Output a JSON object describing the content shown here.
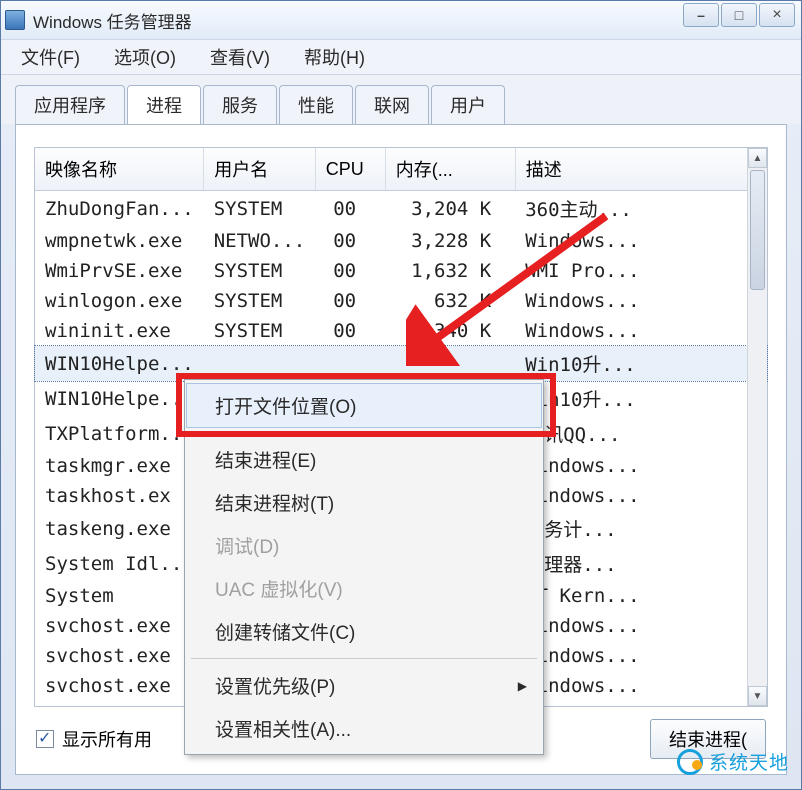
{
  "window": {
    "title": "Windows 任务管理器"
  },
  "menu": {
    "file": "文件(F)",
    "options": "选项(O)",
    "view": "查看(V)",
    "help": "帮助(H)"
  },
  "tabs": {
    "apps": "应用程序",
    "processes": "进程",
    "services": "服务",
    "performance": "性能",
    "networking": "联网",
    "users": "用户"
  },
  "columns": {
    "image": "映像名称",
    "user": "用户名",
    "cpu": "CPU",
    "memory": "内存(...",
    "desc": "描述"
  },
  "rows": [
    {
      "image": "ZhuDongFan...",
      "user": "SYSTEM",
      "cpu": "00",
      "mem": "3,204 K",
      "desc": "360主动..."
    },
    {
      "image": "wmpnetwk.exe",
      "user": "NETWO...",
      "cpu": "00",
      "mem": "3,228 K",
      "desc": "Windows..."
    },
    {
      "image": "WmiPrvSE.exe",
      "user": "SYSTEM",
      "cpu": "00",
      "mem": "1,632 K",
      "desc": "WMI Pro..."
    },
    {
      "image": "winlogon.exe",
      "user": "SYSTEM",
      "cpu": "00",
      "mem": "632 K",
      "desc": "Windows..."
    },
    {
      "image": "wininit.exe",
      "user": "SYSTEM",
      "cpu": "00",
      "mem": "340 K",
      "desc": "Windows..."
    },
    {
      "image": "WIN10Helpe...",
      "user": "",
      "cpu": "",
      "mem": "",
      "desc": "Win10升..."
    },
    {
      "image": "WIN10Helpe...",
      "user": "",
      "cpu": "",
      "mem": "",
      "desc": "Win10升..."
    },
    {
      "image": "TXPlatform...",
      "user": "",
      "cpu": "",
      "mem": "",
      "desc": "腾讯QQ..."
    },
    {
      "image": "taskmgr.exe",
      "user": "",
      "cpu": "",
      "mem": "",
      "desc": "Windows..."
    },
    {
      "image": "taskhost.ex",
      "user": "",
      "cpu": "",
      "mem": "",
      "desc": "Windows..."
    },
    {
      "image": "taskeng.exe",
      "user": "",
      "cpu": "",
      "mem": "",
      "desc": "任务计..."
    },
    {
      "image": "System Idl...",
      "user": "",
      "cpu": "",
      "mem": "",
      "desc": "处理器..."
    },
    {
      "image": "System",
      "user": "",
      "cpu": "",
      "mem": "",
      "desc": "NT Kern..."
    },
    {
      "image": "svchost.exe",
      "user": "",
      "cpu": "",
      "mem": "",
      "desc": "Windows..."
    },
    {
      "image": "svchost.exe",
      "user": "",
      "cpu": "",
      "mem": "",
      "desc": "Windows..."
    },
    {
      "image": "svchost.exe",
      "user": "",
      "cpu": "",
      "mem": "",
      "desc": "Windows..."
    }
  ],
  "selected_row_index": 5,
  "context_menu": {
    "open_location": "打开文件位置(O)",
    "end_process": "结束进程(E)",
    "end_tree": "结束进程树(T)",
    "debug": "调试(D)",
    "uac": "UAC 虚拟化(V)",
    "create_dump": "创建转储文件(C)",
    "priority": "设置优先级(P)",
    "affinity": "设置相关性(A)...",
    "highlighted": "open_location"
  },
  "bottom": {
    "show_all": "显示所有用",
    "end_process_btn": "结束进程("
  },
  "watermark": "系统天地"
}
